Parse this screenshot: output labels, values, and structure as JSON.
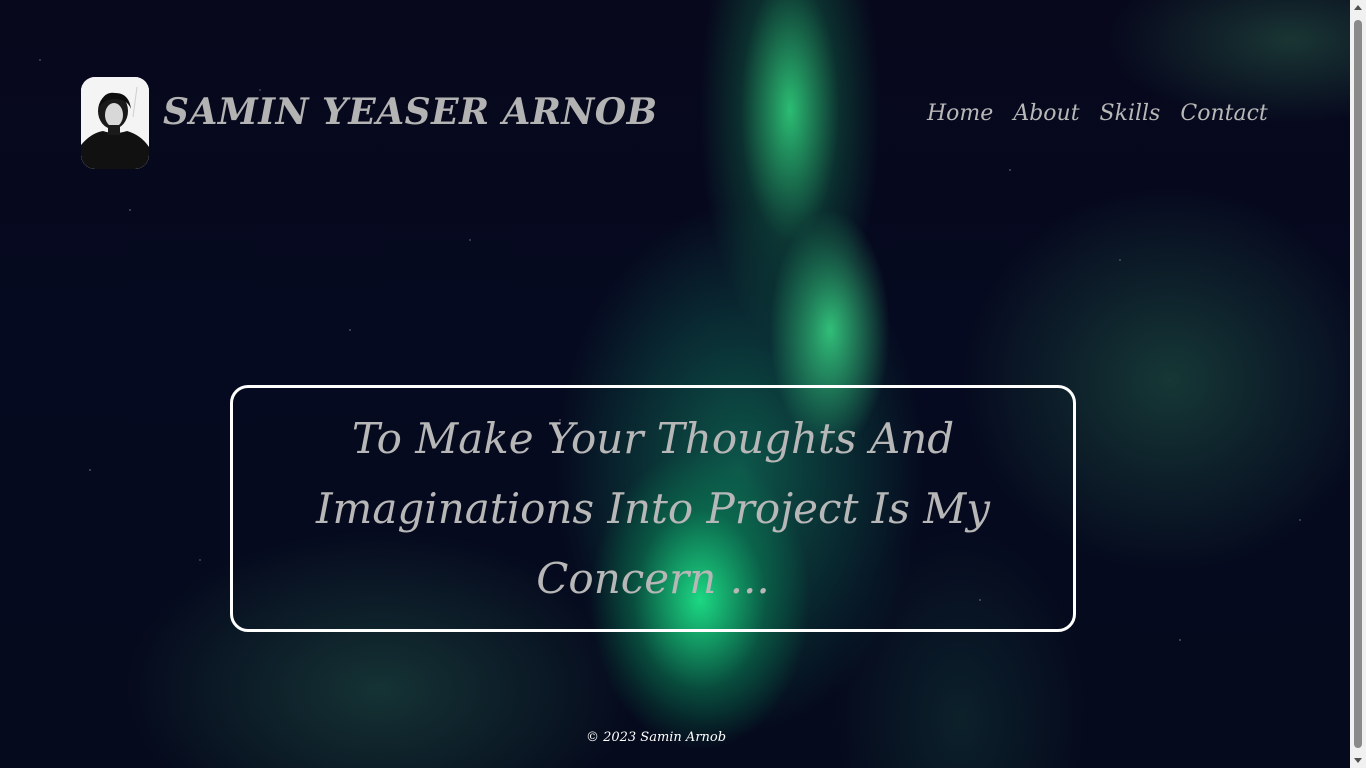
{
  "header": {
    "site_name": "SAMIN YEASER ARNOB",
    "nav": [
      {
        "label": "Home"
      },
      {
        "label": "About"
      },
      {
        "label": "Skills"
      },
      {
        "label": "Contact"
      }
    ]
  },
  "hero": {
    "tagline": "To Make Your Thoughts And Imaginations Into Project Is My Concern ..."
  },
  "footer": {
    "copyright": "© 2023 Samin Arnob"
  },
  "theme": {
    "text_color": "#b7b7b7",
    "box_border_color": "#ffffff",
    "background_dark": "#05071a",
    "aurora_green": "#2ee88e"
  }
}
